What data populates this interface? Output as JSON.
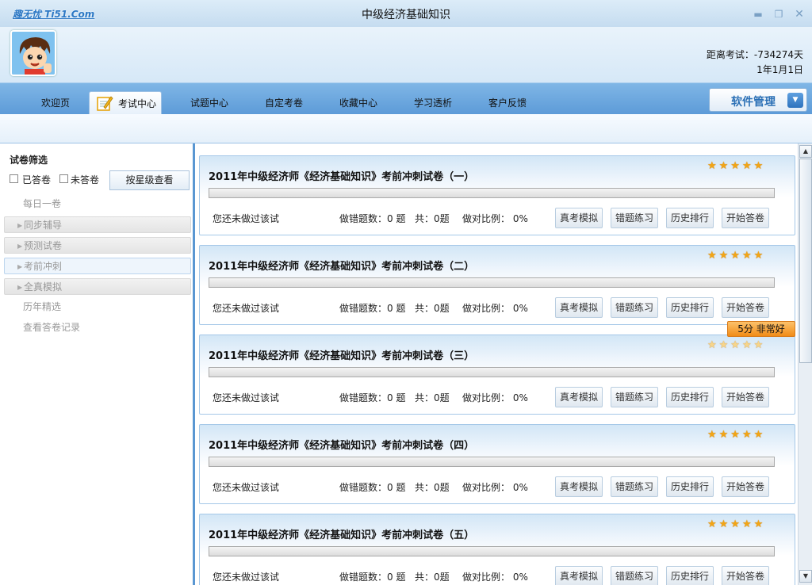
{
  "titlebar": {
    "brand": "趣无忧 Ti51.Com",
    "title": "中级经济基础知识",
    "minimize_icon": "minimize-icon",
    "restore_icon": "restore-icon",
    "close_icon": "close-icon"
  },
  "header": {
    "avatar_icon": "cartoon-avatar",
    "countdown_label": "距离考试：-734274天",
    "exam_date": "1年1月1日"
  },
  "nav": {
    "tabs": [
      {
        "label": "欢迎页",
        "active": false
      },
      {
        "label": "考试中心",
        "active": true,
        "icon": "notepad-pencil-icon"
      },
      {
        "label": "试题中心",
        "active": false
      },
      {
        "label": "自定考卷",
        "active": false
      },
      {
        "label": "收藏中心",
        "active": false
      },
      {
        "label": "学习透析",
        "active": false
      },
      {
        "label": "客户反馈",
        "active": false
      }
    ],
    "software_manage": "软件管理"
  },
  "sidebar": {
    "filter_title": "试卷筛选",
    "answered_label": "已答卷",
    "unanswered_label": "未答卷",
    "star_view_button": "按星级查看",
    "items": [
      {
        "label": "每日一卷",
        "expandable": false
      },
      {
        "label": "同步辅导",
        "expandable": true
      },
      {
        "label": "预测试卷",
        "expandable": true
      },
      {
        "label": "考前冲刺",
        "expandable": true,
        "active": true
      },
      {
        "label": "全真模拟",
        "expandable": true
      },
      {
        "label": "历年精选",
        "expandable": false
      },
      {
        "label": "查看答卷记录",
        "expandable": false
      }
    ]
  },
  "exams": [
    {
      "title": "2011年中级经济师《经济基础知识》考前冲刺试卷（一）",
      "stars": 5,
      "status": "您还未做过该试",
      "wrong_label": "做错题数：0 题",
      "total_label": "共：0题",
      "ratio_label": "做对比例： 0%"
    },
    {
      "title": "2011年中级经济师《经济基础知识》考前冲刺试卷（二）",
      "stars": 5,
      "status": "您还未做过该试",
      "wrong_label": "做错题数：0 题",
      "total_label": "共：0题",
      "ratio_label": "做对比例： 0%"
    },
    {
      "title": "2011年中级经济师《经济基础知识》考前冲刺试卷（三）",
      "stars": 5,
      "status": "您还未做过该试",
      "wrong_label": "做错题数：0 题",
      "total_label": "共：0题",
      "ratio_label": "做对比例： 0%"
    },
    {
      "title": "2011年中级经济师《经济基础知识》考前冲刺试卷（四）",
      "stars": 5,
      "status": "您还未做过该试",
      "wrong_label": "做错题数：0 题",
      "total_label": "共：0题",
      "ratio_label": "做对比例： 0%"
    },
    {
      "title": "2011年中级经济师《经济基础知识》考前冲刺试卷（五）",
      "stars": 5,
      "status": "您还未做过该试",
      "wrong_label": "做错题数：0 题",
      "total_label": "共：0题",
      "ratio_label": "做对比例： 0%"
    }
  ],
  "exam_buttons": {
    "real_sim": "真考模拟",
    "wrong_practice": "错题练习",
    "history_rank": "历史排行",
    "start": "开始答卷"
  },
  "tooltip": "5分 非常好",
  "colors": {
    "nav_blue": "#6aa6de",
    "accent": "#2a6fb5",
    "star": "#f2a516",
    "tooltip": "#f5a23a"
  }
}
